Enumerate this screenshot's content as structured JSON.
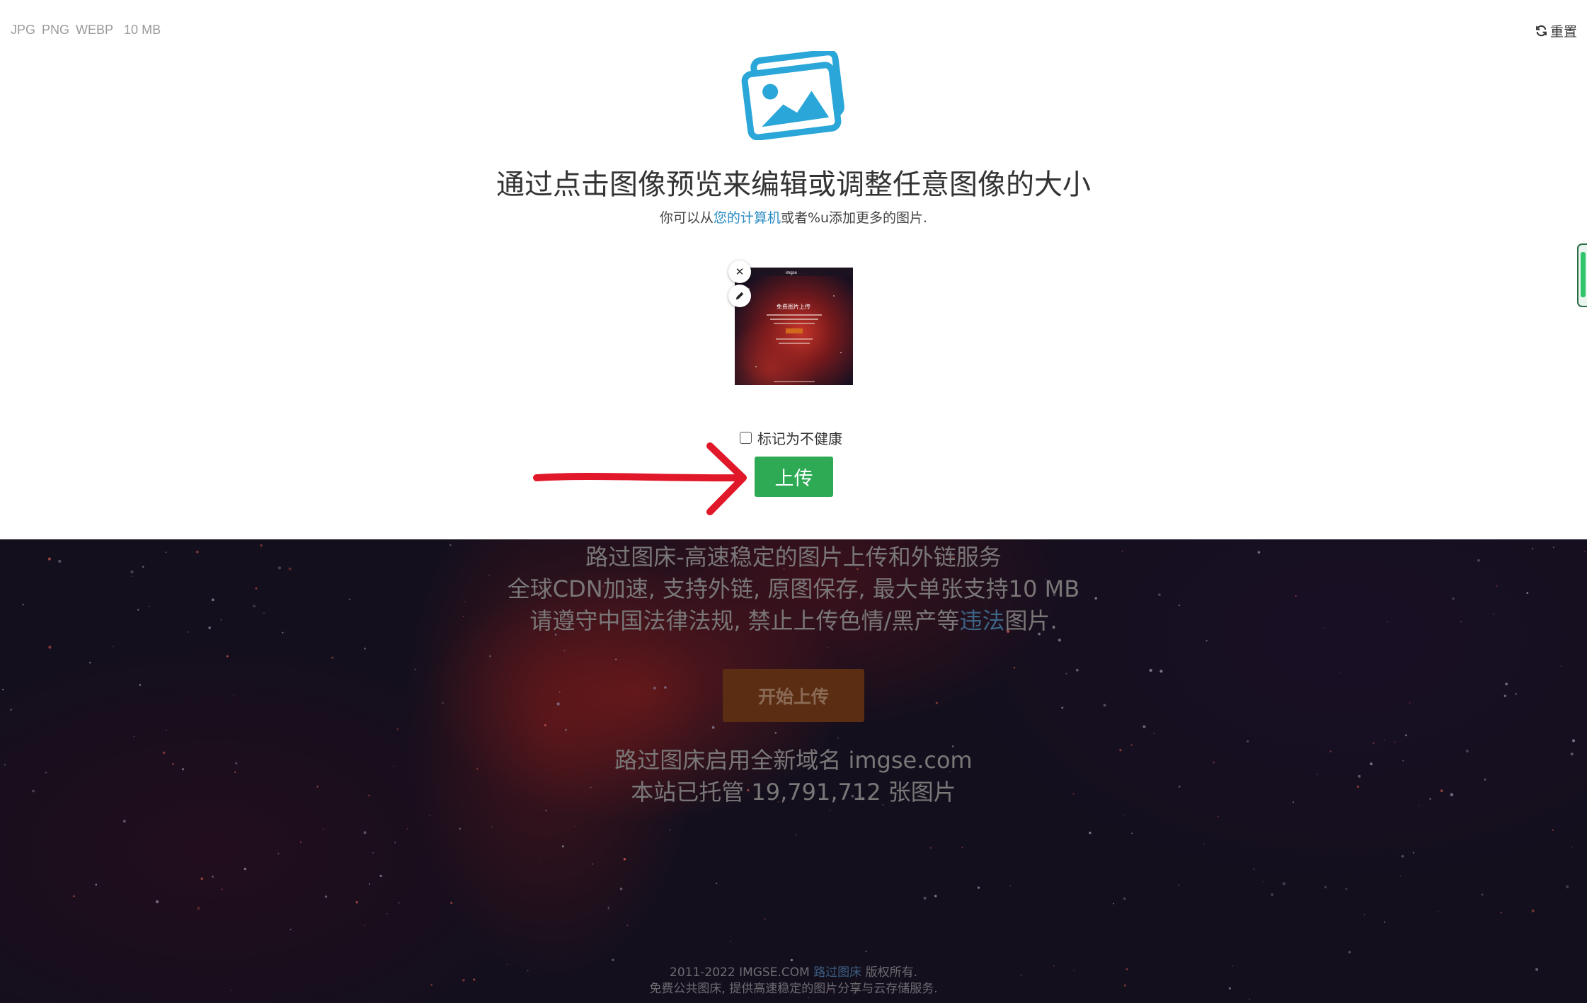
{
  "upload_panel": {
    "formats": [
      "JPG",
      "PNG",
      "WEBP"
    ],
    "max_size": "10 MB",
    "reset_label": "重置",
    "title": "通过点击图像预览来编辑或调整任意图像的大小",
    "subtitle_prefix": "你可以从",
    "subtitle_link": "您的计算机",
    "subtitle_suffix": "或者%u添加更多的图片.",
    "remove_glyph": "✕",
    "nsfw_label": "标记为不健康",
    "upload_button": "上传"
  },
  "home": {
    "line1": "路过图床-高速稳定的图片上传和外链服务",
    "line2": "全球CDN加速, 支持外链, 原图保存, 最大单张支持10 MB",
    "line3_prefix": "请遵守中国法律法规, 禁止上传色情/黑产等",
    "line3_link": "违法",
    "line3_suffix": "图片.",
    "start_button": "开始上传",
    "stats_line1": "路过图床启用全新域名 imgse.com",
    "stats_line2": "本站已托管 19,791,712 张图片"
  },
  "footer": {
    "line1_prefix": "2011-2022 IMGSE.COM ",
    "line1_link": "路过图床",
    "line1_suffix": " 版权所有.",
    "line2": "免费公共图床, 提供高速稳定的图片分享与云存储服务."
  },
  "thumbnail": {
    "site_brand": "imgse",
    "heading": "免费图片上传"
  },
  "colors": {
    "accent_blue": "#2aa6d8",
    "upload_green": "#2eaa55",
    "arrow_red": "#e0182a",
    "start_orange_dim": "#5b2d13"
  }
}
